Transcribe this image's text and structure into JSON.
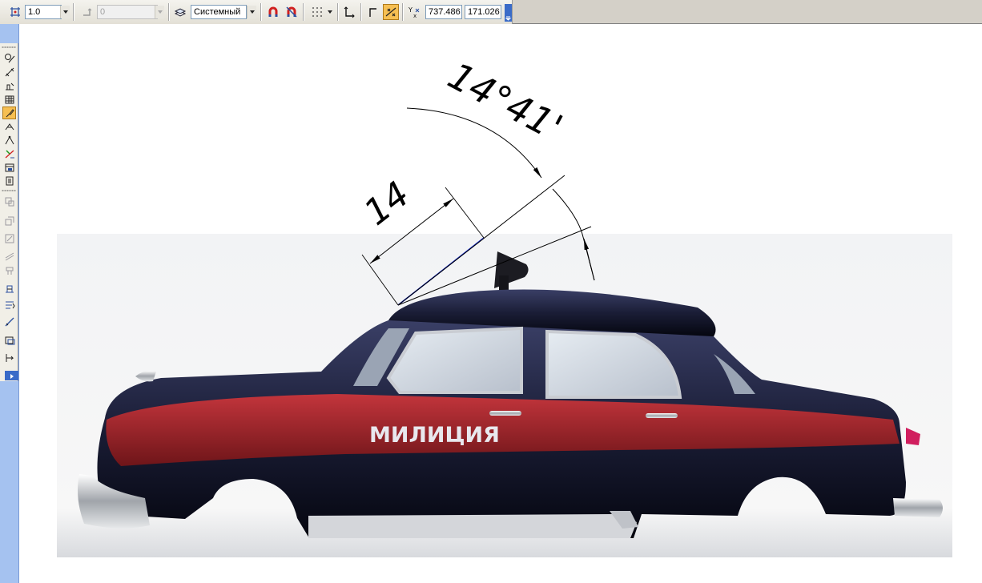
{
  "toolbar": {
    "scale_value": "1.0",
    "step_value": "0",
    "coordinate_system": "Системный",
    "coord_x": "737.486",
    "coord_y": "171.026",
    "coord_label": "Y x"
  },
  "drawing": {
    "linear_dimension": "14",
    "angular_dimension": "14°41'",
    "car_lettering": "МИЛИЦИЯ"
  },
  "colors": {
    "dimension_line": "#000000",
    "measured_segment": "#1a2fd0",
    "active_tool": "#f6bf52",
    "left_strip": "#a5c2f0"
  },
  "icons": [
    "snap-icon",
    "layer-icon",
    "magnet-icon",
    "magnet-off-icon",
    "grid-icon",
    "ortho-icon",
    "local-cs-icon",
    "round-icon",
    "snapping-active-icon"
  ]
}
